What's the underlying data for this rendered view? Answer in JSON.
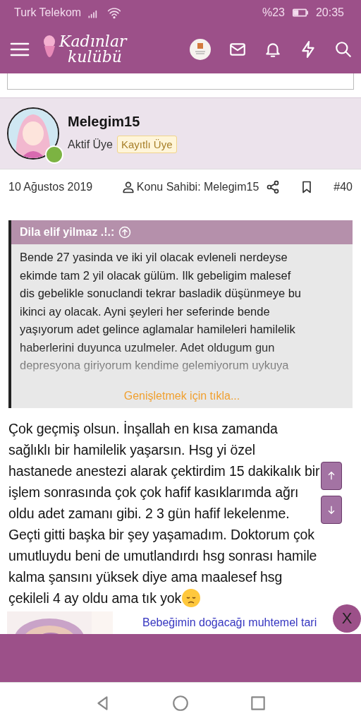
{
  "status_bar": {
    "carrier": "Turk Telekom",
    "battery": "%23",
    "time": "20:35"
  },
  "header": {
    "logo_line_1": "Kadınlar",
    "logo_line_2": "kulübü"
  },
  "post": {
    "author": "Melegim15",
    "role": "Aktif Üye",
    "badge": "Kayıtlı Üye",
    "online": true,
    "date": "10 Ağustos 2019",
    "owner": "Konu Sahibi: Melegim15",
    "number": "#40",
    "quote": {
      "author": "Dila elif yilmaz .!.:",
      "lines": [
        "Bende 27 yasinda ve iki yil olacak evleneli nerdeyse",
        "ekimde tam 2 yil olacak gülüm. Ilk gebeligim malesef",
        "dis gebelikle sonuclandi tekrar basladik düşünmeye bu",
        "ikinci ay olacak. Ayni şeyleri her seferinde bende",
        "yaşıyorum adet gelince aglamalar hamileleri hamilelik",
        "haberlerini duyunca uzulmeler. Adet oldugum gun",
        "depresyona giriyorum kendime gelemiyorum uykuya"
      ],
      "expand": "Genişletmek için tıkla..."
    },
    "body_lines": [
      "Çok geçmiş olsun. İnşallah en kısa zamanda",
      "sağlıklı bir hamilelik yaşarsın. Hsg yi özel",
      "hastanede anestezi alarak çektirdim 15 dakikalık bir",
      "işlem sonrasında çok çok hafif kasıklarımda ağrı",
      "oldu adet zamanı gibi. 2 3 gün hafif lekelenme.",
      "Geçti gitti başka bir şey yaşamadım. Doktorum çok",
      "umutluydu beni de umutlandırdı hsg sonrası hamile",
      "kalma şansını yüksek diye ama maalesef hsg",
      "çekileli 4 ay oldu ama tık yok"
    ]
  },
  "ad": {
    "title": "Bebeğimin doğacağı muhtemel tari",
    "close": "X"
  }
}
